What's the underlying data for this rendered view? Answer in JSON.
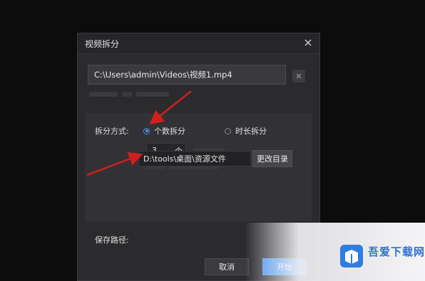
{
  "dialog": {
    "title": "视频拆分",
    "file_path": "C:\\Users\\admin\\Videos\\视频1.mp4",
    "split_mode_label": "拆分方式:",
    "options": [
      {
        "label": "个数拆分",
        "selected": true
      },
      {
        "label": "时长拆分",
        "selected": false
      }
    ],
    "count_value": "3",
    "count_unit": "个",
    "save_path_label": "保存路径:",
    "save_path": "D:\\tools\\桌面\\资源文件",
    "change_dir_label": "更改目录",
    "cancel_label": "取消",
    "start_label": "开始"
  },
  "watermark": {
    "name": "吾爱下载网"
  },
  "colors": {
    "accent": "#3d8ef0",
    "arrow": "#d0201e",
    "dialog_bg": "#2b2b2e"
  }
}
